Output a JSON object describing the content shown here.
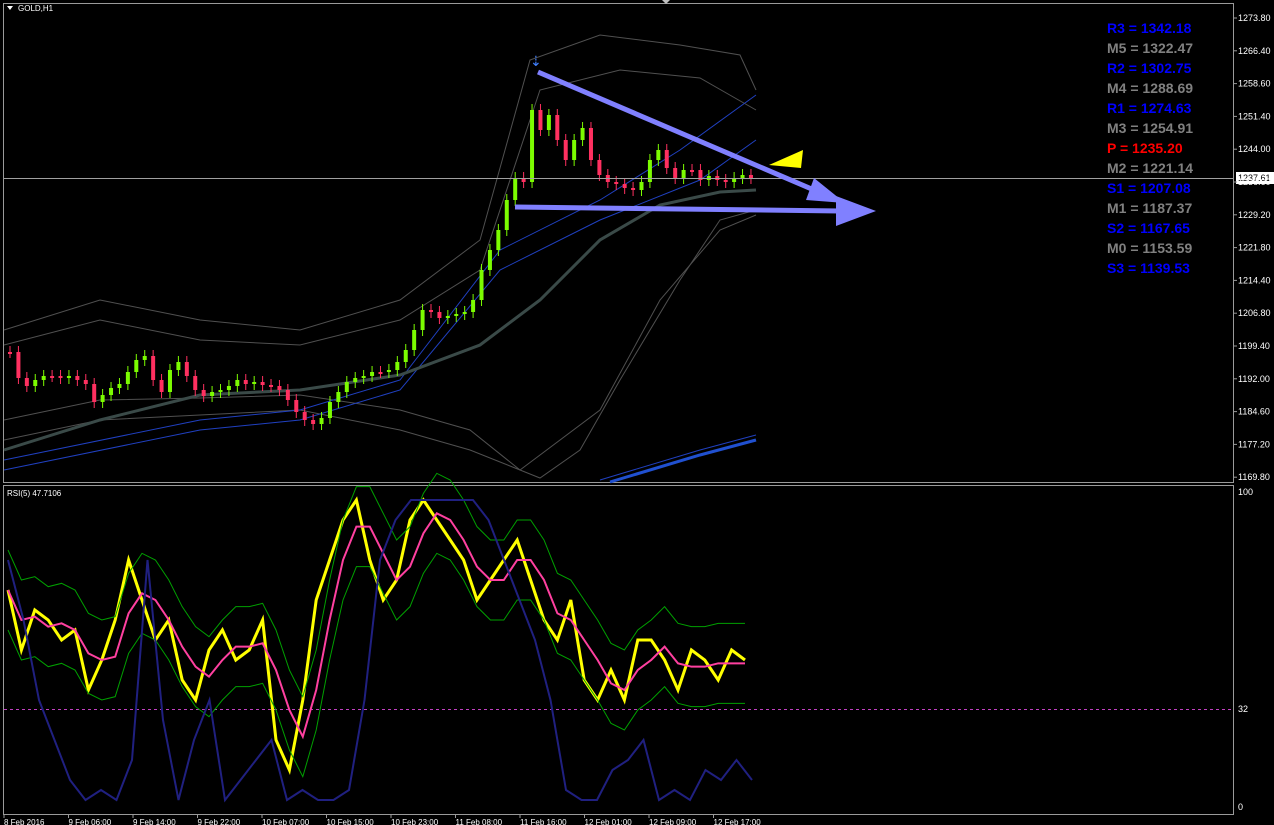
{
  "main_chart": {
    "symbol_timeframe": "GOLD,H1",
    "current_price": "1237.61",
    "price_axis": [
      "1273.80",
      "1266.40",
      "1258.60",
      "1251.40",
      "1244.00",
      "1236.60",
      "1229.20",
      "1221.80",
      "1214.40",
      "1206.80",
      "1199.40",
      "1192.00",
      "1184.60",
      "1177.20",
      "1169.80"
    ]
  },
  "pivots": [
    {
      "label": "R3 = 1342.18",
      "color": "#0000ff"
    },
    {
      "label": "M5 = 1322.47",
      "color": "#808080"
    },
    {
      "label": "R2 = 1302.75",
      "color": "#0000ff"
    },
    {
      "label": "M4 = 1288.69",
      "color": "#808080"
    },
    {
      "label": "R1 = 1274.63",
      "color": "#0000ff"
    },
    {
      "label": "M3 = 1254.91",
      "color": "#808080"
    },
    {
      "label": "P  = 1235.20",
      "color": "#ff0000"
    },
    {
      "label": "M2 = 1221.14",
      "color": "#808080"
    },
    {
      "label": "S1 = 1207.08",
      "color": "#0000ff"
    },
    {
      "label": "M1 = 1187.37",
      "color": "#808080"
    },
    {
      "label": "S2 = 1167.65",
      "color": "#0000ff"
    },
    {
      "label": "M0 = 1153.59",
      "color": "#808080"
    },
    {
      "label": "S3 = 1139.53",
      "color": "#0000ff"
    }
  ],
  "rsi_panel": {
    "title": "RSI(5) 47.7106",
    "level_high": "100",
    "level_mid": "32",
    "level_low": "0"
  },
  "time_axis": [
    "8 Feb 2016",
    "9 Feb 06:00",
    "9 Feb 14:00",
    "9 Feb 22:00",
    "10 Feb 07:00",
    "10 Feb 15:00",
    "10 Feb 23:00",
    "11 Feb 08:00",
    "11 Feb 16:00",
    "12 Feb 01:00",
    "12 Feb 09:00",
    "12 Feb 17:00"
  ],
  "colors": {
    "bull_candle": "#7cfc00",
    "bear_candle": "#ff3060",
    "arrow": "#8080ff",
    "triangle": "#ffff00",
    "rsi_line": "#ffff00",
    "rsi_ma": "#ff40a0",
    "rsi_band": "#00a000",
    "rsi_blue": "#202080",
    "bollinger": "#505050"
  }
}
